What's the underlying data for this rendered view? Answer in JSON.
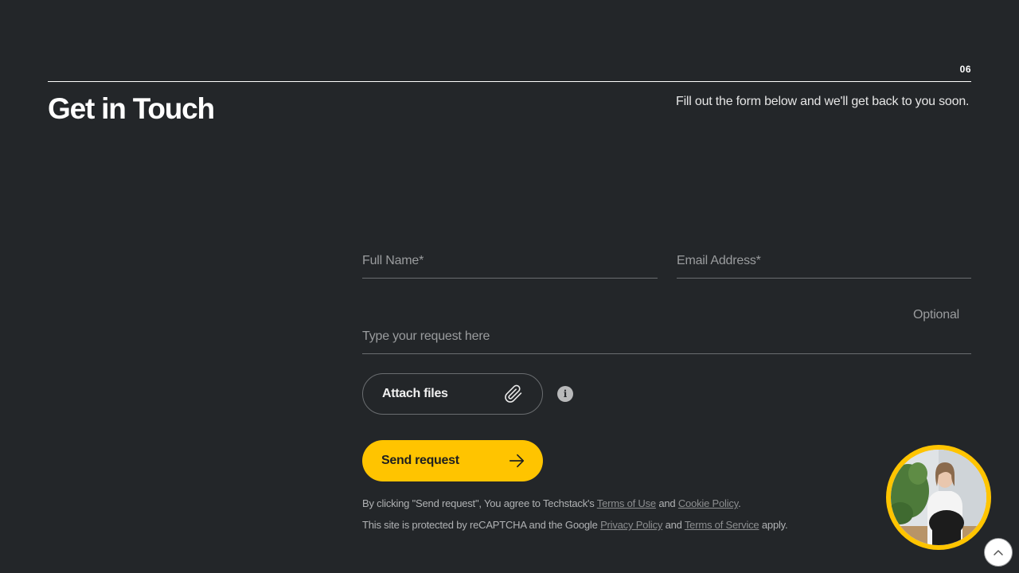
{
  "section": {
    "number": "06",
    "title": "Get in Touch",
    "subtitle": "Fill out the form below and we'll get back to you soon."
  },
  "form": {
    "full_name_placeholder": "Full Name*",
    "email_placeholder": "Email Address*",
    "request_placeholder": "Type your request here",
    "optional_label": "Optional",
    "attach_label": "Attach files",
    "info_label": "i",
    "send_label": "Send request"
  },
  "legal": {
    "line1_prefix": "By clicking \"Send request\", You agree to Techstack's ",
    "terms_of_use": "Terms of Use",
    "line1_and": " and ",
    "cookie_policy": "Cookie Policy",
    "line1_suffix": ".",
    "line2_prefix": "This site is protected by reCAPTCHA and the Google ",
    "privacy_policy": "Privacy Policy",
    "line2_and": " and ",
    "terms_of_service": "Terms of Service",
    "line2_suffix": " apply."
  },
  "icons": {
    "attach": "paperclip-icon",
    "send": "arrow-right-icon",
    "info": "info-icon",
    "scroll_top": "chevron-up-icon"
  },
  "colors": {
    "background": "#232629",
    "accent": "#ffc400",
    "text": "#ffffff",
    "muted": "#9a9c9e"
  }
}
